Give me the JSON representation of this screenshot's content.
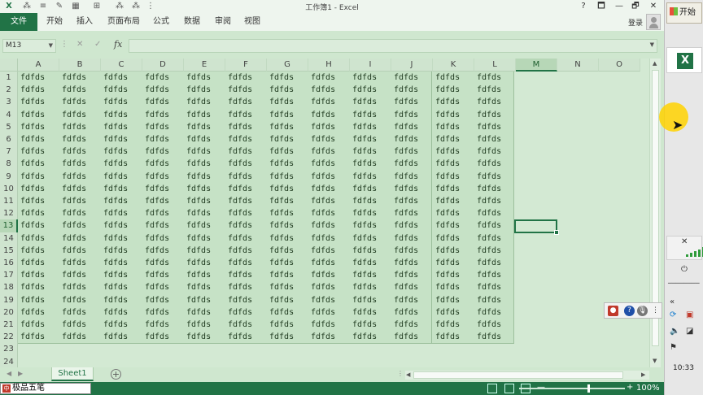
{
  "window": {
    "title": "工作簿1 - Excel",
    "controls": [
      "?",
      "🗖",
      "—",
      "🗗",
      "✕"
    ]
  },
  "ribbon": {
    "file_tab": "文件",
    "tabs": [
      "开始",
      "插入",
      "页面布局",
      "公式",
      "数据",
      "审阅",
      "视图"
    ],
    "login": "登录"
  },
  "formula_bar": {
    "name_box": "M13",
    "fx": "fx",
    "formula": ""
  },
  "grid": {
    "columns": [
      "A",
      "B",
      "C",
      "D",
      "E",
      "F",
      "G",
      "H",
      "I",
      "J",
      "K",
      "L",
      "M",
      "N",
      "O"
    ],
    "rows": [
      "1",
      "2",
      "3",
      "4",
      "5",
      "6",
      "7",
      "8",
      "9",
      "10",
      "11",
      "12",
      "13",
      "14",
      "15",
      "16",
      "17",
      "18",
      "19",
      "20",
      "21",
      "22",
      "23",
      "24"
    ],
    "selected_column": "M",
    "selected_row": "13",
    "cell_value": "fdfds",
    "filled_rows": 22,
    "filled_columns": 12
  },
  "sheets": {
    "tabs": [
      "Sheet1"
    ],
    "add_label": "+"
  },
  "status_bar": {
    "ime": "极品五笔",
    "zoom": "100%",
    "zoom_minus": "—",
    "zoom_plus": "+"
  },
  "taskbar": {
    "start_label": "开始",
    "app_icon_letter": "X",
    "clock": "10:33"
  },
  "colors": {
    "accent": "#217346",
    "sheet_bg": "#cfe7cf",
    "highlight": "#ffd200"
  }
}
